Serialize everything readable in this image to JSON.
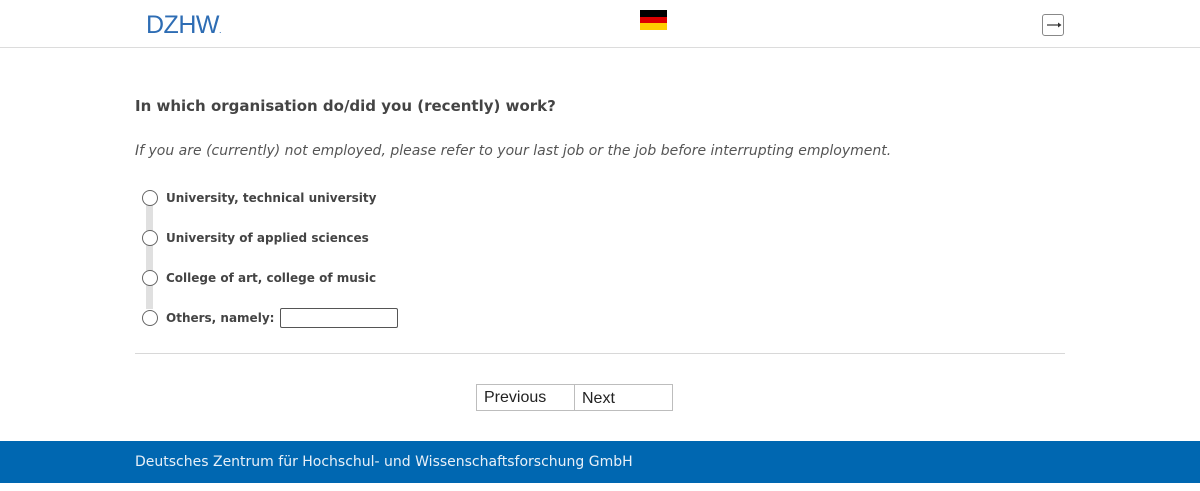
{
  "header": {
    "logo_text": "DZHW",
    "logo_dot": ".",
    "flag_colors": [
      "#000000",
      "#dd0000",
      "#ffce00"
    ],
    "logout_icon": "logout-icon"
  },
  "survey": {
    "question": "In which organisation do/did you (recently) work?",
    "instruction": "If you are (currently) not employed, please refer to your last job or the job before interrupting employment.",
    "options": [
      {
        "label": "University, technical university"
      },
      {
        "label": "University of applied sciences"
      },
      {
        "label": "College of art, college of music"
      },
      {
        "label": "Others, namely:"
      }
    ],
    "other_value": ""
  },
  "navigation": {
    "previous_label": "Previous",
    "next_label": "Next"
  },
  "footer": {
    "text": "Deutsches Zentrum für Hochschul- und Wissenschaftsforschung GmbH",
    "color": "#0067b1"
  }
}
